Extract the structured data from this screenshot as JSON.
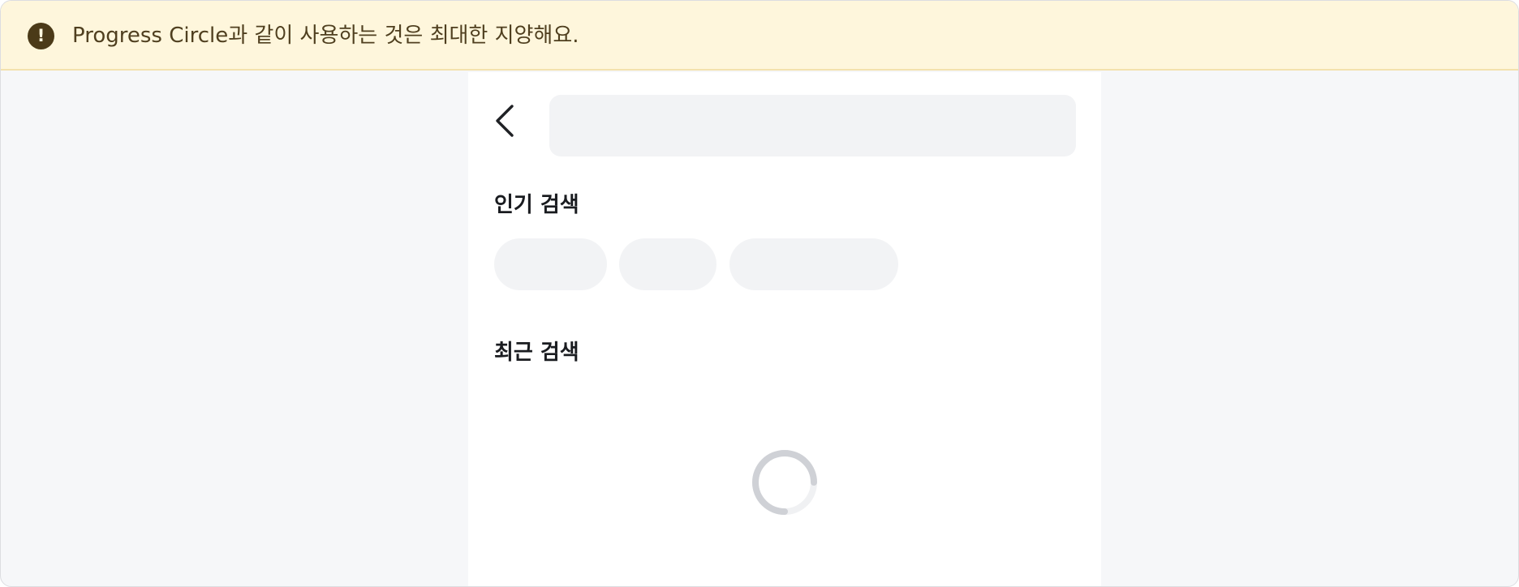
{
  "banner": {
    "icon": "exclamation-circle-icon",
    "icon_glyph": "!",
    "message": "Progress Circle과 같이 사용하는 것은 최대한 지양해요.",
    "background_color": "#fef6dc",
    "text_color": "#4f3f1f"
  },
  "header": {
    "back_icon": "chevron-left-icon"
  },
  "sections": {
    "popular_title": "인기 검색",
    "recent_title": "최근 검색"
  },
  "loading": {
    "icon": "progress-circle-icon"
  }
}
